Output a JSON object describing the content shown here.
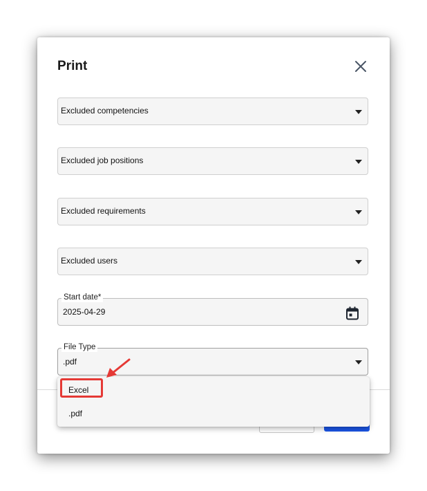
{
  "dialog": {
    "title": "Print",
    "close_icon": "close-icon"
  },
  "filters": [
    {
      "label": "Excluded competencies"
    },
    {
      "label": "Excluded job positions"
    },
    {
      "label": "Excluded requirements"
    },
    {
      "label": "Excluded users"
    }
  ],
  "start_date": {
    "label": "Start date*",
    "value": "2025-04-29",
    "icon": "calendar-icon"
  },
  "file_type": {
    "label": "File Type",
    "value": ".pdf",
    "options": [
      "Excel",
      ".pdf"
    ]
  },
  "annotation": {
    "highlight_color": "#e53935",
    "highlighted_option": "Excel"
  },
  "colors": {
    "primary_button": "#1a55e6",
    "field_background": "#f5f5f5"
  }
}
